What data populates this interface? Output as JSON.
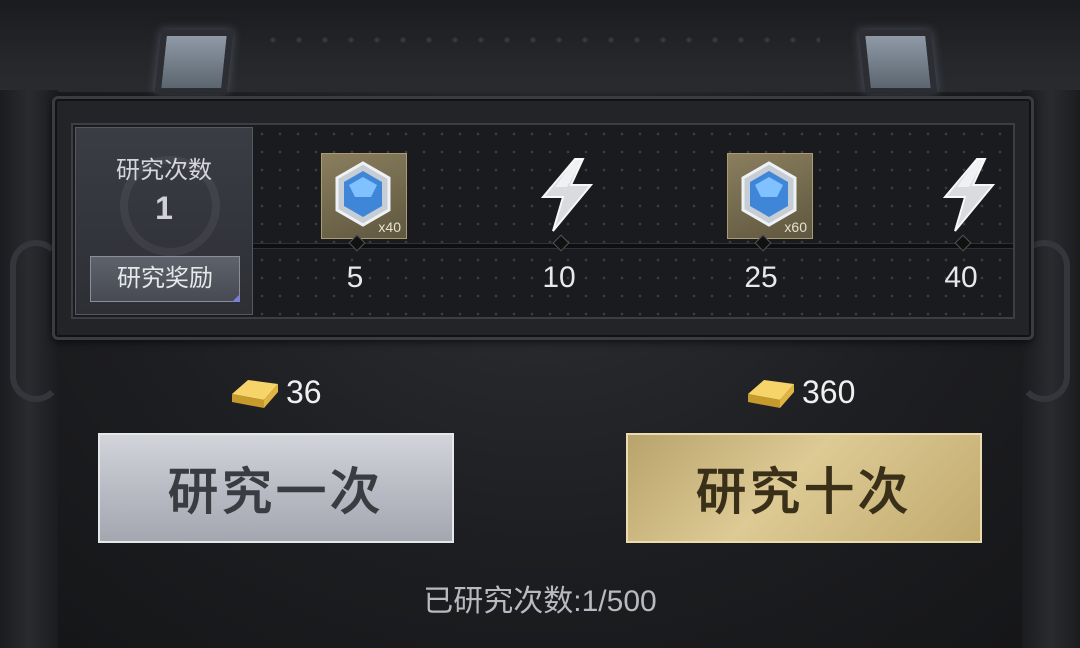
{
  "reward_panel": {
    "count_label": "研究次数",
    "count_value": "1",
    "reward_button": "研究奖励",
    "milestones": [
      {
        "number": "5",
        "icon": "blue-gem-icon",
        "badge": "x40"
      },
      {
        "number": "10",
        "icon": "silver-lightning-icon",
        "badge": ""
      },
      {
        "number": "25",
        "icon": "blue-gem-icon",
        "badge": "x60"
      },
      {
        "number": "40",
        "icon": "silver-lightning-icon",
        "badge": ""
      }
    ]
  },
  "actions": {
    "single": {
      "cost": "36",
      "label": "研究一次",
      "icon": "gold-bar-icon"
    },
    "ten": {
      "cost": "360",
      "label": "研究十次",
      "icon": "gold-bar-icon"
    }
  },
  "progress_text": "已研究次数:1/500",
  "colors": {
    "gold_button": "#d2bd86",
    "silver_button": "#c2c5cc",
    "background": "#232428"
  }
}
